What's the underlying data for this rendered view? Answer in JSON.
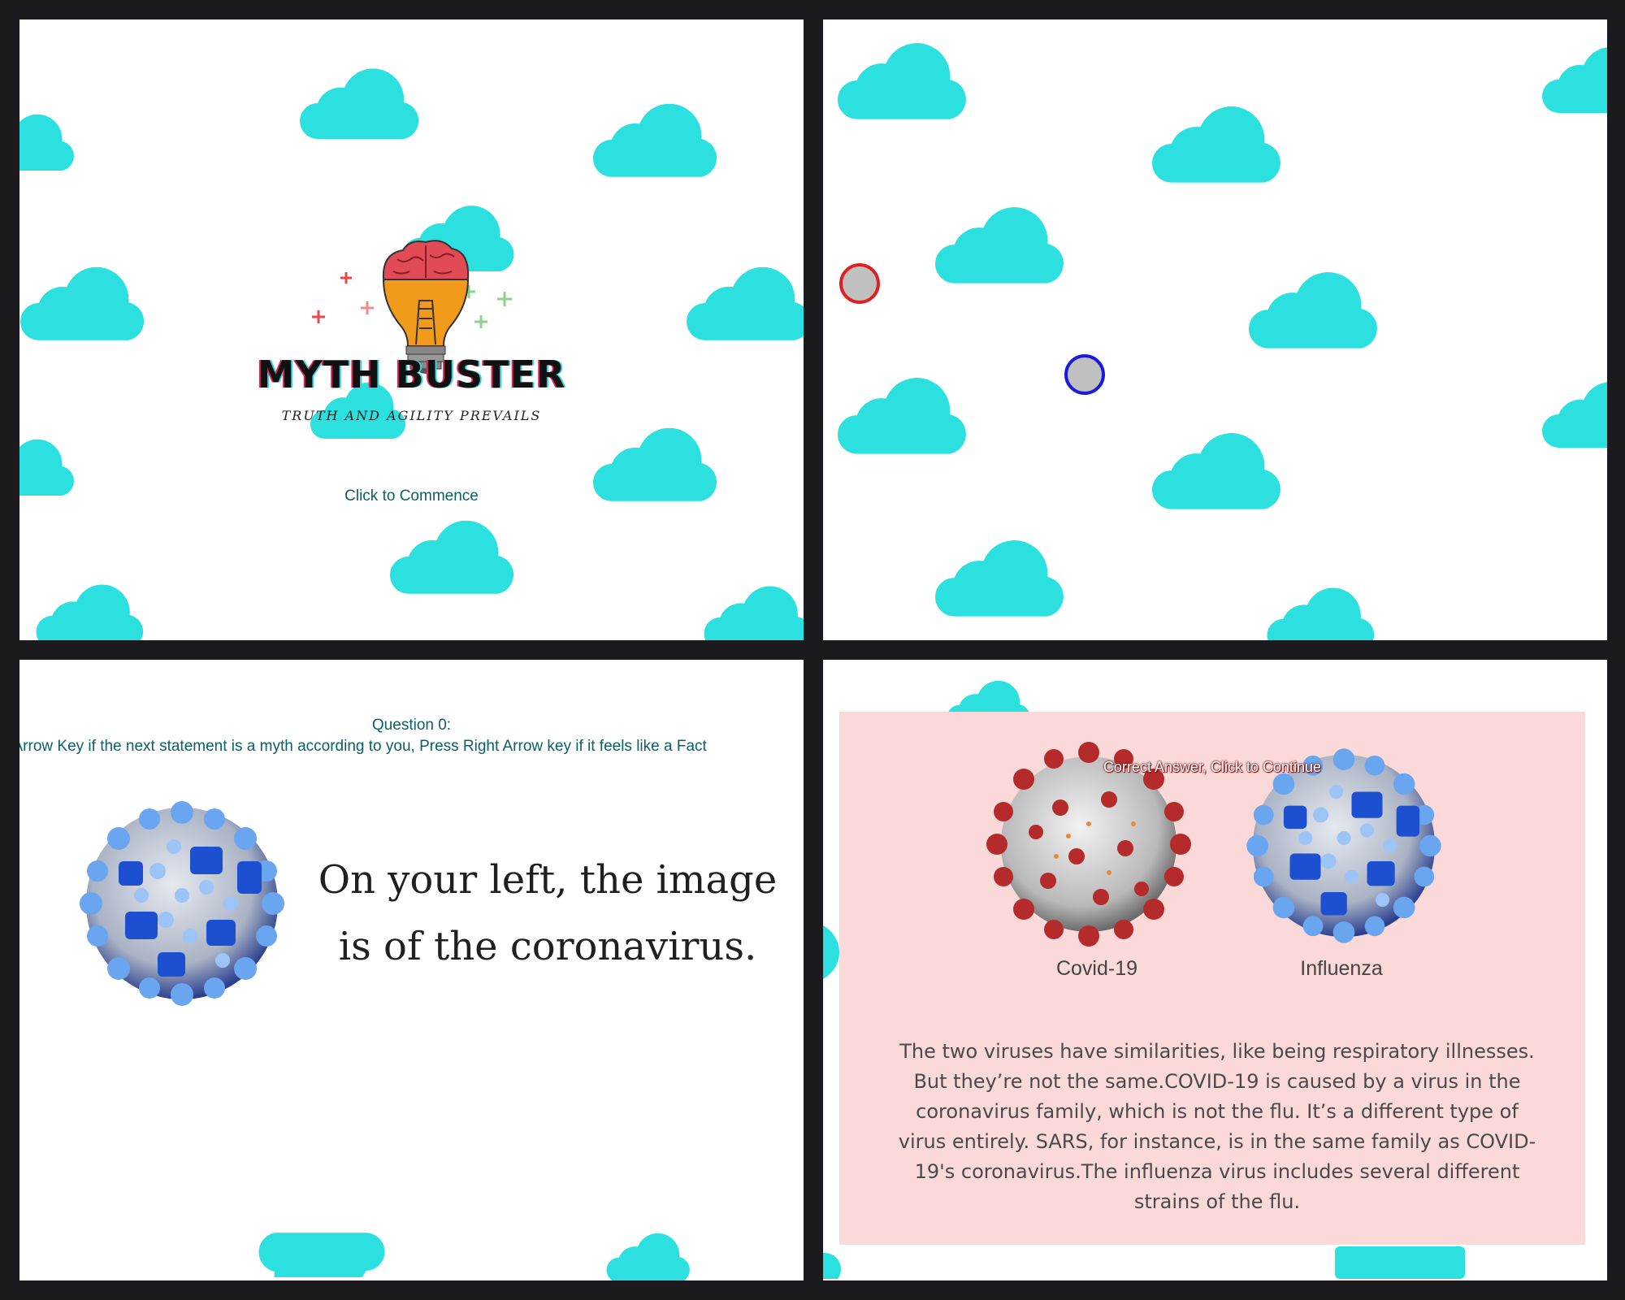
{
  "colors": {
    "cloud": "#2ce0e0",
    "panel_bg": "#ffffff",
    "frame_bg": "#1b1b1f",
    "pink_box": "#fbd9d9",
    "teal_text": "#0b5f66"
  },
  "start_screen": {
    "logo_icon": "brain-lightbulb-icon",
    "title": "MYTH BUSTER",
    "tagline": "TRUTH AND AGILITY PREVAILS",
    "commence_link": "Click to Commence"
  },
  "game_screen": {
    "dot_colors": [
      "#e02020",
      "#1a1adf"
    ]
  },
  "question_screen": {
    "question_number": "Question 0:",
    "instruction": "t Arrow Key if the next statement is a myth according to you, Press Right Arrow key if it feels like a Fact",
    "image_icon": "influenza-virus-icon",
    "statement_line1": "On your left, the image",
    "statement_line2": "is of the coronavirus."
  },
  "answer_screen": {
    "feedback": "Correct Answer, Click to Continue",
    "virus_left_label": "Covid-19",
    "virus_right_label": "Influenza",
    "explanation": "The two viruses have similarities, like being respiratory illnesses. But they’re not the same.COVID-19 is caused by a virus in the coronavirus family, which is not the flu. It’s a different type of virus entirely. SARS, for instance, is in the same family as COVID-19's coronavirus.The influenza virus includes several different strains of the flu."
  }
}
